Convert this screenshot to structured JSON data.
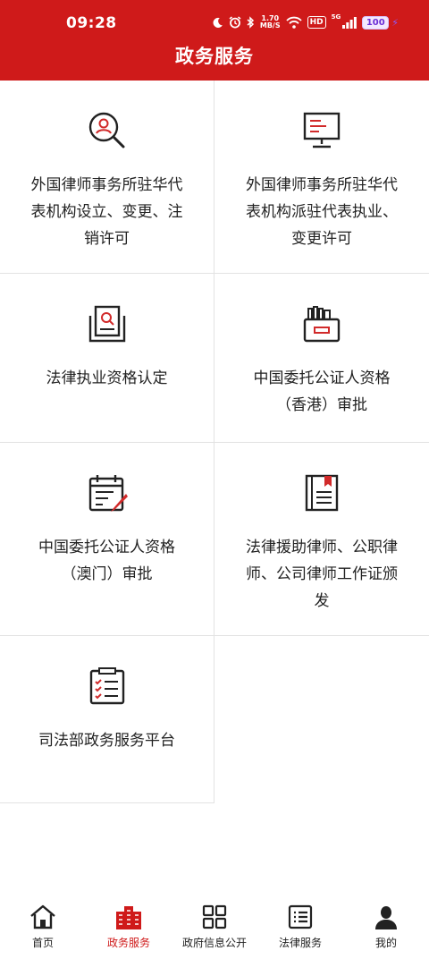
{
  "status_bar": {
    "time": "09:28",
    "network_speed_value": "1.70",
    "network_speed_unit": "MB/S",
    "hd_label": "HD",
    "signal_label": "5G",
    "battery": "100"
  },
  "header": {
    "title": "政务服务"
  },
  "services": [
    {
      "label": "外国律师事务所驻华代表机构设立、变更、注销许可",
      "icon": "search-person-icon"
    },
    {
      "label": "外国律师事务所驻华代表机构派驻代表执业、变更许可",
      "icon": "monitor-icon"
    },
    {
      "label": "法律执业资格认定",
      "icon": "document-search-icon"
    },
    {
      "label": "中国委托公证人资格（香港）审批",
      "icon": "file-box-icon"
    },
    {
      "label": "中国委托公证人资格（澳门）审批",
      "icon": "calendar-pen-icon"
    },
    {
      "label": "法律援助律师、公职律师、公司律师工作证颁发",
      "icon": "bookmark-book-icon"
    },
    {
      "label": "司法部政务服务平台",
      "icon": "checklist-icon"
    }
  ],
  "tabbar": {
    "items": [
      {
        "label": "首页",
        "icon": "home-icon",
        "active": false
      },
      {
        "label": "政务服务",
        "icon": "building-icon",
        "active": true
      },
      {
        "label": "政府信息公开",
        "icon": "grid-icon",
        "active": false
      },
      {
        "label": "法律服务",
        "icon": "list-icon",
        "active": false
      },
      {
        "label": "我的",
        "icon": "person-icon",
        "active": false
      }
    ]
  },
  "colors": {
    "brand_red": "#cf1a1a",
    "text": "#222222",
    "divider": "#e2e2e2"
  }
}
